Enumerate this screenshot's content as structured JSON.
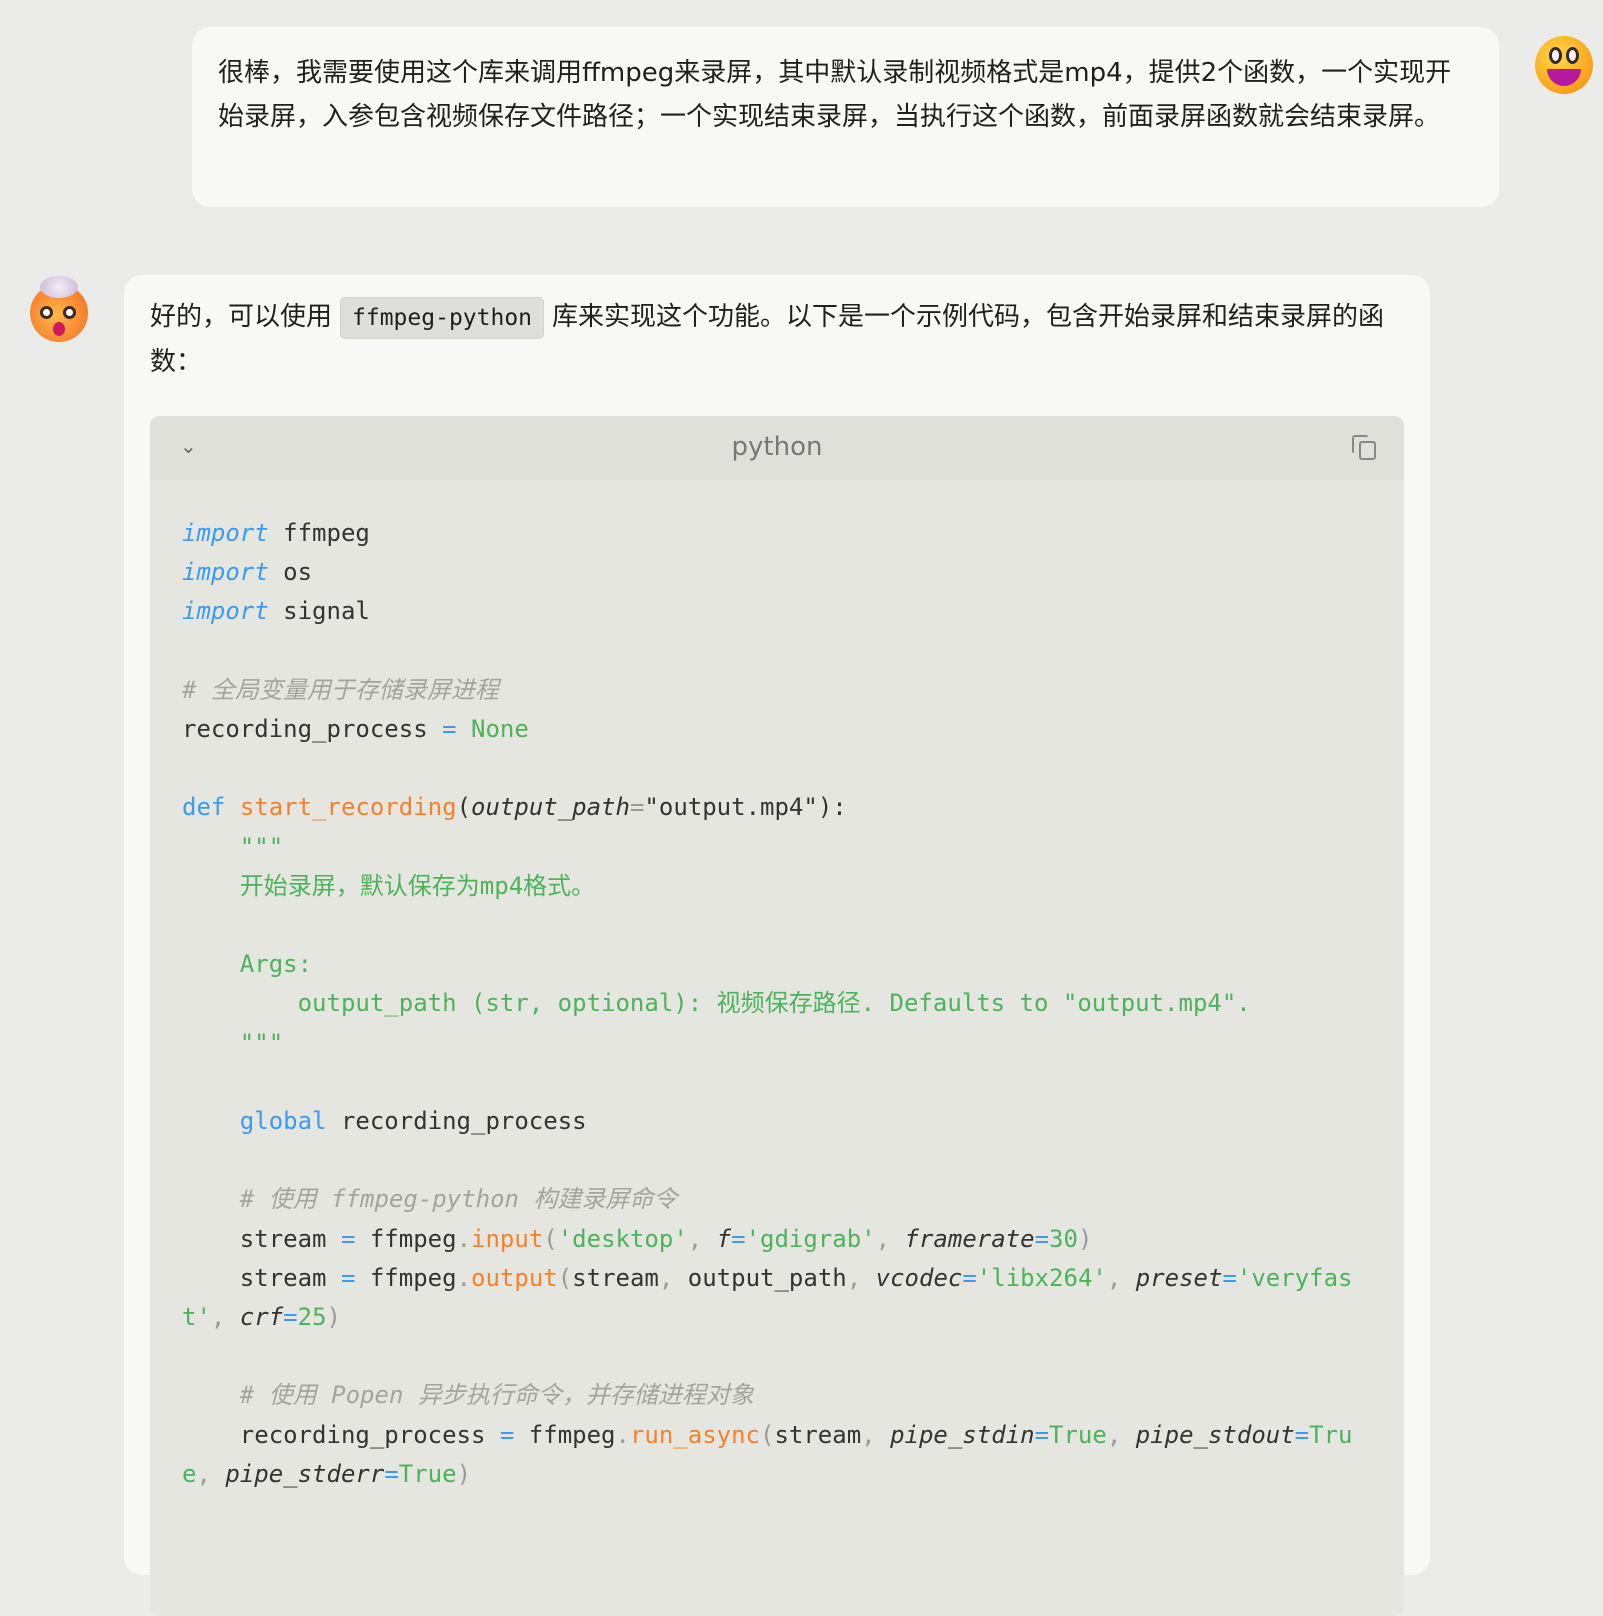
{
  "user_message": "很棒，我需要使用这个库来调用ffmpeg来录屏，其中默认录制视频格式是mp4，提供2个函数，一个实现开始录屏，入参包含视频保存文件路径；一个实现结束录屏，当执行这个函数，前面录屏函数就会结束录屏。",
  "assistant": {
    "intro_before": "好的，可以使用",
    "inline_code": "ffmpeg-python",
    "intro_after": "库来实现这个功能。以下是一个示例代码，包含开始录屏和结束录屏的函数：",
    "code_language": "python",
    "code_lines": [
      [
        [
          "kwi",
          "import"
        ],
        [
          "t",
          " ffmpeg"
        ]
      ],
      [
        [
          "kwi",
          "import"
        ],
        [
          "t",
          " os"
        ]
      ],
      [
        [
          "kwi",
          "import"
        ],
        [
          "t",
          " signal"
        ]
      ],
      [],
      [
        [
          "cm",
          "# 全局变量用于存储录屏进程"
        ]
      ],
      [
        [
          "t",
          "recording_process "
        ],
        [
          "op",
          "="
        ],
        [
          "num",
          " None"
        ]
      ],
      [],
      [
        [
          "kw",
          "def"
        ],
        [
          "t",
          " "
        ],
        [
          "fn",
          "start_recording"
        ],
        [
          "t",
          "("
        ],
        [
          "pa",
          "output_path"
        ],
        [
          "p",
          "="
        ],
        [
          "t",
          "\"output.mp4\"):"
        ]
      ],
      [
        [
          "doc",
          "    \"\"\""
        ]
      ],
      [
        [
          "doc",
          "    开始录屏，默认保存为mp4格式。"
        ]
      ],
      [],
      [
        [
          "doc",
          "    Args:"
        ]
      ],
      [
        [
          "doc",
          "        output_path (str, optional): 视频保存路径. Defaults to \"output.mp4\"."
        ]
      ],
      [
        [
          "doc",
          "    \"\"\""
        ]
      ],
      [],
      [
        [
          "t",
          "    "
        ],
        [
          "kw",
          "global"
        ],
        [
          "t",
          " recording_process"
        ]
      ],
      [],
      [
        [
          "cm",
          "    # 使用 ffmpeg-python 构建录屏命令"
        ]
      ],
      [
        [
          "t",
          "    stream "
        ],
        [
          "op",
          "="
        ],
        [
          "t",
          " ffmpeg"
        ],
        [
          "p",
          "."
        ],
        [
          "fn",
          "input"
        ],
        [
          "p",
          "("
        ],
        [
          "str",
          "'desktop'"
        ],
        [
          "p",
          ", "
        ],
        [
          "pa",
          "f"
        ],
        [
          "op",
          "="
        ],
        [
          "str",
          "'gdigrab'"
        ],
        [
          "p",
          ", "
        ],
        [
          "pa",
          "framerate"
        ],
        [
          "op",
          "="
        ],
        [
          "num",
          "30"
        ],
        [
          "p",
          ")"
        ]
      ],
      [
        [
          "t",
          "    stream "
        ],
        [
          "op",
          "="
        ],
        [
          "t",
          " ffmpeg"
        ],
        [
          "p",
          "."
        ],
        [
          "fn",
          "output"
        ],
        [
          "p",
          "("
        ],
        [
          "t",
          "stream"
        ],
        [
          "p",
          ", "
        ],
        [
          "t",
          "output_path"
        ],
        [
          "p",
          ", "
        ],
        [
          "pa",
          "vcodec"
        ],
        [
          "op",
          "="
        ],
        [
          "str",
          "'libx264'"
        ],
        [
          "p",
          ", "
        ],
        [
          "pa",
          "preset"
        ],
        [
          "op",
          "="
        ],
        [
          "str",
          "'veryfast'"
        ],
        [
          "p",
          ", "
        ],
        [
          "pa",
          "crf"
        ],
        [
          "op",
          "="
        ],
        [
          "num",
          "25"
        ],
        [
          "p",
          ")"
        ]
      ],
      [],
      [
        [
          "cm",
          "    # 使用 Popen 异步执行命令，并存储进程对象"
        ]
      ],
      [
        [
          "t",
          "    recording_process "
        ],
        [
          "op",
          "="
        ],
        [
          "t",
          " ffmpeg"
        ],
        [
          "p",
          "."
        ],
        [
          "fn",
          "run_async"
        ],
        [
          "p",
          "("
        ],
        [
          "t",
          "stream"
        ],
        [
          "p",
          ", "
        ],
        [
          "pa",
          "pipe_stdin"
        ],
        [
          "op",
          "="
        ],
        [
          "num",
          "True"
        ],
        [
          "p",
          ", "
        ],
        [
          "pa",
          "pipe_stdout"
        ],
        [
          "op",
          "="
        ],
        [
          "num",
          "True"
        ],
        [
          "p",
          ", "
        ],
        [
          "pa",
          "pipe_stderr"
        ],
        [
          "op",
          "="
        ],
        [
          "num",
          "True"
        ],
        [
          "p",
          ")"
        ]
      ]
    ]
  }
}
